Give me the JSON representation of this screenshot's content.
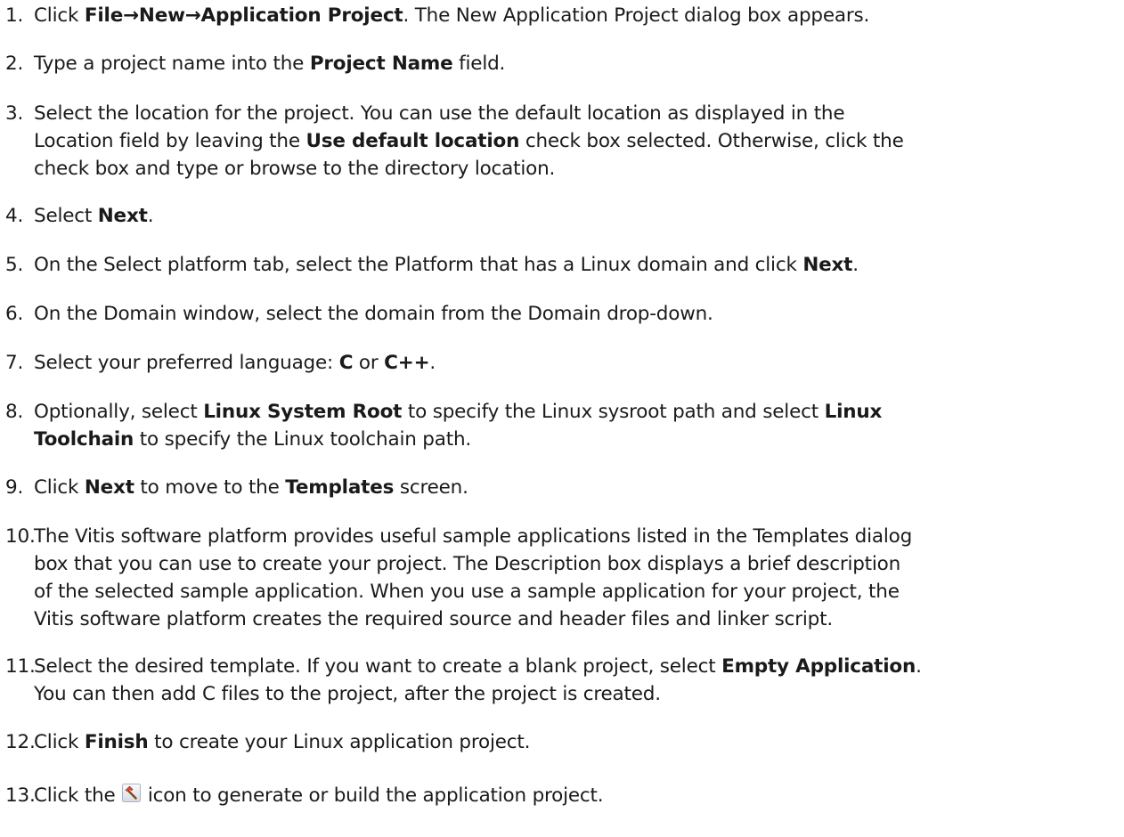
{
  "steps": [
    {
      "number": "1.",
      "parts": [
        {
          "t": "Click ",
          "b": false
        },
        {
          "t": "File→New→Application Project",
          "b": true
        },
        {
          "t": ". The New Application Project dialog box appears.",
          "b": false
        }
      ]
    },
    {
      "number": "2.",
      "parts": [
        {
          "t": "Type a project name into the ",
          "b": false
        },
        {
          "t": "Project Name",
          "b": true
        },
        {
          "t": " field.",
          "b": false
        }
      ]
    },
    {
      "number": "3.",
      "parts": [
        {
          "t": "Select the location for the project. You can use the default location as displayed in the",
          "b": false,
          "br": true
        },
        {
          "t": "Location field by leaving the ",
          "b": false
        },
        {
          "t": "Use default location",
          "b": true
        },
        {
          "t": " check box selected. Otherwise, click the",
          "b": false,
          "br": true
        },
        {
          "t": "check box and type or browse to the directory location.",
          "b": false
        }
      ]
    },
    {
      "number": "4.",
      "parts": [
        {
          "t": "Select ",
          "b": false
        },
        {
          "t": "Next",
          "b": true
        },
        {
          "t": ".",
          "b": false
        }
      ]
    },
    {
      "number": "5.",
      "parts": [
        {
          "t": "On the Select platform tab, select the Platform that has a Linux domain and click ",
          "b": false
        },
        {
          "t": "Next",
          "b": true
        },
        {
          "t": ".",
          "b": false
        }
      ]
    },
    {
      "number": "6.",
      "parts": [
        {
          "t": "On the Domain window, select the domain from the Domain drop-down.",
          "b": false
        }
      ]
    },
    {
      "number": "7.",
      "parts": [
        {
          "t": "Select your preferred language: ",
          "b": false
        },
        {
          "t": "C",
          "b": true
        },
        {
          "t": " or ",
          "b": false
        },
        {
          "t": "C++",
          "b": true
        },
        {
          "t": ".",
          "b": false
        }
      ]
    },
    {
      "number": "8.",
      "parts": [
        {
          "t": "Optionally, select ",
          "b": false
        },
        {
          "t": "Linux System Root",
          "b": true
        },
        {
          "t": " to specify the Linux sysroot path and select ",
          "b": false
        },
        {
          "t": "Linux",
          "b": true,
          "br": true
        },
        {
          "t": "Toolchain",
          "b": true
        },
        {
          "t": " to specify the Linux toolchain path.",
          "b": false
        }
      ]
    },
    {
      "number": "9.",
      "parts": [
        {
          "t": "Click ",
          "b": false
        },
        {
          "t": "Next",
          "b": true
        },
        {
          "t": " to move to the ",
          "b": false
        },
        {
          "t": "Templates",
          "b": true
        },
        {
          "t": " screen.",
          "b": false
        }
      ]
    },
    {
      "number": "10.",
      "parts": [
        {
          "t": "The Vitis software platform provides useful sample applications listed in the Templates dialog",
          "b": false,
          "br": true
        },
        {
          "t": "box that you can use to create your project. The Description box displays a brief description",
          "b": false,
          "br": true
        },
        {
          "t": "of the selected sample application. When you use a sample application for your project, the",
          "b": false,
          "br": true
        },
        {
          "t": "Vitis software platform creates the required source and header files and linker script.",
          "b": false
        }
      ]
    },
    {
      "number": "11.",
      "parts": [
        {
          "t": "Select the desired template. If you want to create a blank project, select ",
          "b": false
        },
        {
          "t": "Empty Application",
          "b": true
        },
        {
          "t": ".",
          "b": false,
          "br": true
        },
        {
          "t": "You can then add C files to the project, after the project is created.",
          "b": false
        }
      ]
    },
    {
      "number": "12.",
      "parts": [
        {
          "t": "Click ",
          "b": false
        },
        {
          "t": "Finish",
          "b": true
        },
        {
          "t": " to create your Linux application project.",
          "b": false
        }
      ]
    },
    {
      "number": "13.",
      "parts": [
        {
          "t": "Click the ",
          "b": false
        },
        {
          "icon": "hammer-build-icon"
        },
        {
          "t": " icon to generate or build the application project.",
          "b": false
        }
      ]
    }
  ]
}
